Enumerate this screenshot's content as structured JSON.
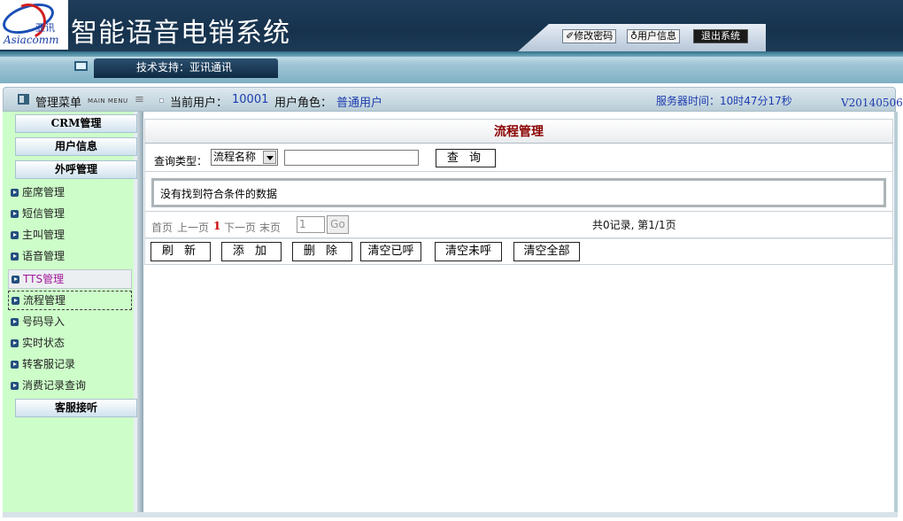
{
  "header": {
    "logo_cn": "亚讯",
    "logo_en": "Asiacomm",
    "title": "智能语音电销系统",
    "buttons": {
      "change_password": "✐修改密码",
      "user_info": "♁用户信息",
      "logout": "退出系统"
    }
  },
  "subbar": {
    "tech_support": "技术支持：亚讯通讯"
  },
  "statusbar": {
    "menu_title": "管理菜单",
    "menu_title_en": "MAIN MENU",
    "current_user_label": "当前用户：",
    "current_user_value": "10001",
    "role_label": "用户角色：",
    "role_value": "普通用户",
    "server_time": "服务器时间：10时47分17秒",
    "version": "V20140506"
  },
  "sidebar": {
    "groups": {
      "crm": "CRM管理",
      "user_info": "用户信息",
      "outbound": "外呼管理",
      "agent_listen": "客服接听"
    },
    "items": [
      {
        "label": "座席管理"
      },
      {
        "label": "短信管理"
      },
      {
        "label": "主叫管理"
      },
      {
        "label": "语音管理"
      },
      {
        "label": "TTS管理"
      },
      {
        "label": "流程管理"
      },
      {
        "label": "号码导入"
      },
      {
        "label": "实时状态"
      },
      {
        "label": "转客服记录"
      },
      {
        "label": "消费记录查询"
      }
    ]
  },
  "content": {
    "heading": "流程管理",
    "query": {
      "label": "查询类型：",
      "select_value": "流程名称",
      "input_value": "",
      "button": "查 询"
    },
    "no_data": "没有找到符合条件的数据",
    "pager": {
      "first": "首页",
      "prev": "上一页",
      "current": "1",
      "next": "下一页",
      "last": "末页",
      "page_input": "1",
      "go": "Go",
      "summary": "共0记录, 第1/1页"
    },
    "actions": {
      "refresh": "刷 新",
      "add": "添 加",
      "delete": "删 除",
      "clear_called": "清空已呼",
      "clear_uncalled": "清空未呼",
      "clear_all": "清空全部"
    }
  }
}
